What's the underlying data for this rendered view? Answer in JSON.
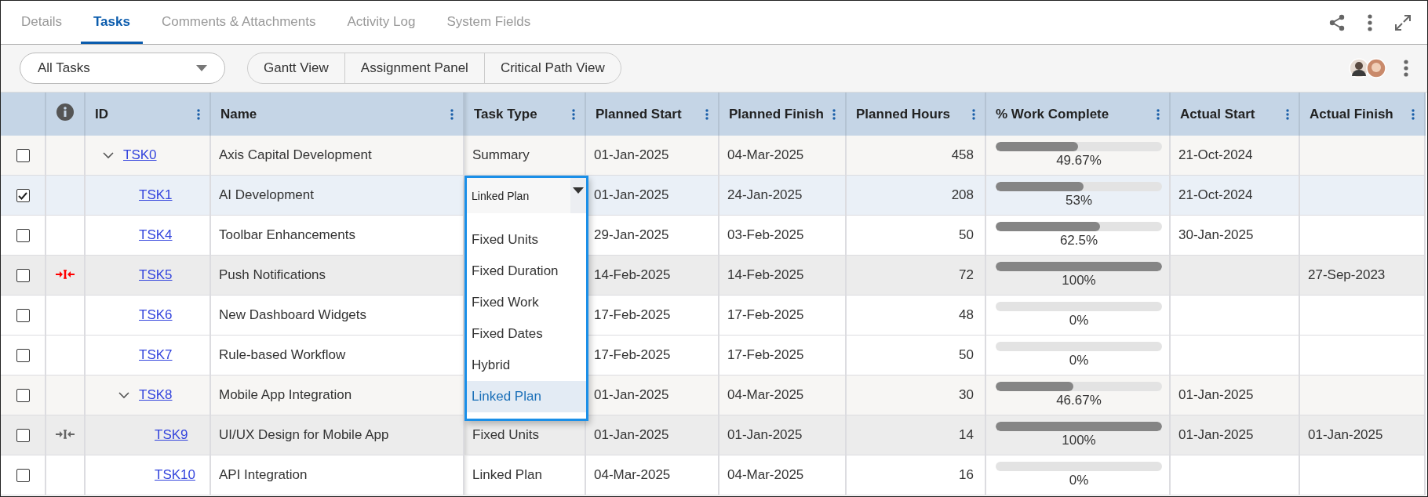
{
  "tabs": [
    {
      "label": "Details",
      "selected": false
    },
    {
      "label": "Tasks",
      "selected": true
    },
    {
      "label": "Comments & Attachments",
      "selected": false
    },
    {
      "label": "Activity Log",
      "selected": false
    },
    {
      "label": "System Fields",
      "selected": false
    }
  ],
  "filter": {
    "value": "All Tasks"
  },
  "views": [
    "Gantt View",
    "Assignment Panel",
    "Critical Path View"
  ],
  "columns": [
    "ID",
    "Name",
    "Task Type",
    "Planned Start",
    "Planned Finish",
    "Planned Hours",
    "% Work Complete",
    "Actual Start",
    "Actual Finish"
  ],
  "rows": [
    {
      "id": "TSK0",
      "name": "Axis Capital Development",
      "kind": "summary",
      "selected": false,
      "expanded": true,
      "task_type": "Summary",
      "planned_start": "01-Jan-2025",
      "planned_finish": "04-Mar-2025",
      "planned_hours": "458",
      "work_complete": {
        "level": 0.4967,
        "text": "49.67%"
      },
      "actual_start": "21-Oct-2024",
      "children": [
        {
          "id": "TSK1",
          "name": "AI Development",
          "kind": "task",
          "selected": true,
          "task_type": "Linked Plan",
          "editor": {
            "options": [
              {
                "label": "Fixed Units",
                "selected": false
              },
              {
                "label": "Fixed Duration",
                "selected": false
              },
              {
                "label": "Fixed Work",
                "selected": false
              },
              {
                "label": "Fixed Dates",
                "selected": false
              },
              {
                "label": "Hybrid",
                "selected": false
              },
              {
                "label": "Linked Plan",
                "selected": true
              }
            ]
          },
          "planned_start": "01-Jan-2025",
          "planned_finish": "24-Jan-2025",
          "planned_hours": "208",
          "work_complete": {
            "level": 0.53,
            "text": "53%"
          },
          "actual_start": "21-Oct-2024"
        },
        {
          "id": "TSK4",
          "name": "Toolbar Enhancements",
          "kind": "task",
          "selected": false,
          "planned_start": "29-Jan-2025",
          "planned_finish": "03-Feb-2025",
          "planned_hours": "50",
          "work_complete": {
            "level": 0.625,
            "text": "62.5%"
          },
          "actual_start": "30-Jan-2025"
        },
        {
          "id": "TSK5",
          "name": "Push Notifications",
          "kind": "linked",
          "color": "#ff0000",
          "selected": false,
          "planned_start": "14-Feb-2025",
          "planned_finish": "14-Feb-2025",
          "planned_hours": "72",
          "work_complete": {
            "level": 1,
            "text": "100%"
          },
          "actual_finish": "27-Sep-2023"
        },
        {
          "id": "TSK6",
          "name": "New Dashboard Widgets",
          "kind": "task",
          "selected": false,
          "planned_start": "17-Feb-2025",
          "planned_finish": "17-Feb-2025",
          "planned_hours": "48",
          "work_complete": {
            "level": 0,
            "text": "0%"
          }
        },
        {
          "id": "TSK7",
          "name": "Rule-based Workflow",
          "kind": "task",
          "selected": false,
          "planned_start": "17-Feb-2025",
          "planned_finish": "17-Feb-2025",
          "planned_hours": "50",
          "work_complete": {
            "level": 0,
            "text": "0%"
          }
        },
        {
          "id": "TSK8",
          "name": "Mobile App Integration",
          "kind": "summary",
          "selected": false,
          "expanded": true,
          "planned_start": "01-Jan-2025",
          "planned_finish": "04-Mar-2025",
          "planned_hours": "30",
          "work_complete": {
            "level": 0.4667,
            "text": "46.67%"
          },
          "actual_start": "01-Jan-2025",
          "children": [
            {
              "id": "TSK9",
              "name": "UI/UX Design for Mobile App",
              "kind": "linked",
              "color": "#666666",
              "selected": false,
              "task_type": "Fixed Units",
              "planned_start": "01-Jan-2025",
              "planned_finish": "01-Jan-2025",
              "planned_hours": "14",
              "work_complete": {
                "level": 1,
                "text": "100%"
              },
              "actual_start": "01-Jan-2025",
              "actual_finish": "01-Jan-2025"
            },
            {
              "id": "TSK10",
              "name": "API Integration",
              "kind": "task",
              "selected": false,
              "task_type": "Linked Plan",
              "planned_start": "04-Mar-2025",
              "planned_finish": "04-Mar-2025",
              "planned_hours": "16",
              "work_complete": {
                "level": 0,
                "text": "0%"
              }
            }
          ]
        }
      ]
    }
  ]
}
